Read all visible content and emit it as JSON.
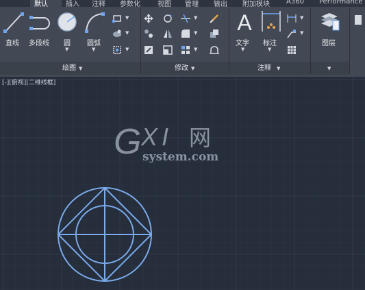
{
  "tabs": [
    {
      "label": "默认",
      "active": true
    },
    {
      "label": "插入",
      "active": false
    },
    {
      "label": "注释",
      "active": false
    },
    {
      "label": "参数化",
      "active": false
    },
    {
      "label": "视图",
      "active": false
    },
    {
      "label": "管理",
      "active": false
    },
    {
      "label": "输出",
      "active": false
    },
    {
      "label": "附加模块",
      "active": false
    },
    {
      "label": "A360",
      "active": false
    },
    {
      "label": "Performance",
      "active": false
    }
  ],
  "draw_panel": {
    "title": "绘图",
    "tools": {
      "line": "直线",
      "polyline": "多段线",
      "circle": "圆",
      "arc": "圆弧"
    }
  },
  "modify_panel": {
    "title": "修改"
  },
  "annotation_panel": {
    "title": "注释",
    "tools": {
      "text": "文字",
      "dimension": "标注"
    }
  },
  "layers_panel": {
    "tools": {
      "layer": "图层"
    }
  },
  "viewport": {
    "label": "[-][俯视][二维线框]"
  },
  "watermark": {
    "text": "GXI网",
    "url": "system.com"
  },
  "colors": {
    "accent": "#6fa4f0",
    "ribbon": "#434954",
    "canvas": "#262d3b"
  }
}
